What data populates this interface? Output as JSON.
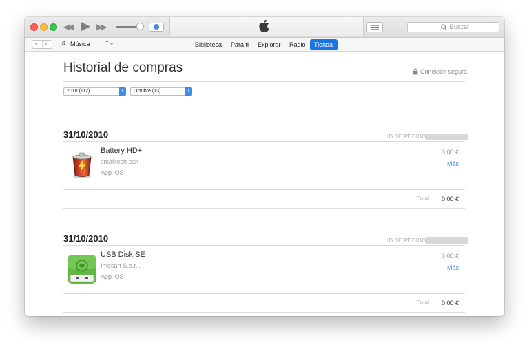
{
  "window": {
    "search_placeholder": "Buscar",
    "media_type": "Música"
  },
  "nav": {
    "tabs": [
      {
        "label": "Biblioteca"
      },
      {
        "label": "Para ti"
      },
      {
        "label": "Explorar"
      },
      {
        "label": "Radio"
      },
      {
        "label": "Tienda",
        "selected": true
      }
    ]
  },
  "page": {
    "title": "Historial de compras",
    "secure_label": "Conexión segura",
    "year_filter": "2010 (112)",
    "month_filter": "Octubre (13)"
  },
  "orders": [
    {
      "date": "31/10/2010",
      "id_label": "ID DE PEDIDO",
      "item": {
        "name": "Battery HD+",
        "developer": "smalltech sarl",
        "type": "App iOS",
        "price": "0,00 €",
        "more": "Más",
        "icon": "battery-hd-app-icon"
      },
      "total_label": "Total",
      "total": "0,00 €"
    },
    {
      "date": "31/10/2010",
      "id_label": "ID DE PEDIDO",
      "item": {
        "name": "USB Disk SE",
        "developer": "Imesart S.a.r.l.",
        "type": "App iOS",
        "price": "0,00 €",
        "more": "Más",
        "icon": "usb-disk-app-icon"
      },
      "total_label": "Total",
      "total": "0,00 €"
    }
  ],
  "colors": {
    "accent": "#1976e0",
    "link": "#3b8ae0"
  }
}
